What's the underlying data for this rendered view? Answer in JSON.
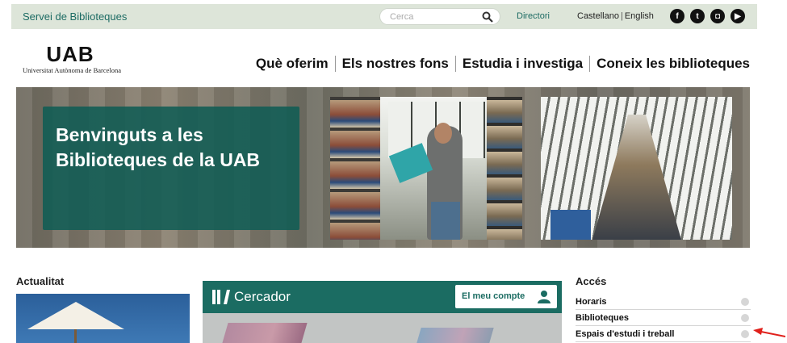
{
  "topbar": {
    "site_name": "Servei de Biblioteques",
    "search_placeholder": "Cerca",
    "directory": "Directori",
    "lang_castellano": "Castellano",
    "lang_separator": "|",
    "lang_english": "English",
    "social": [
      {
        "icon": "facebook-icon",
        "glyph": "f"
      },
      {
        "icon": "twitter-icon",
        "glyph": "t"
      },
      {
        "icon": "instagram-icon",
        "glyph": "◘"
      },
      {
        "icon": "youtube-icon",
        "glyph": "▶"
      }
    ]
  },
  "header": {
    "logo_text": "UAB",
    "logo_subtitle": "Universitat Autònoma de Barcelona",
    "nav": [
      "Què oferim",
      "Els nostres fons",
      "Estudia i investiga",
      "Coneix les biblioteques"
    ]
  },
  "banner": {
    "welcome": "Benvinguts a les Biblioteques de la UAB"
  },
  "news": {
    "title": "Actualitat"
  },
  "cercador": {
    "title": "Cercador",
    "account_button": "El meu compte"
  },
  "acces": {
    "title": "Accés",
    "links": [
      "Horaris",
      "Biblioteques",
      "Espais d'estudi i treball"
    ]
  },
  "colors": {
    "brand_green": "#1b6c62",
    "topbar_bg": "#dde5d9",
    "annotation_arrow": "#e0201b"
  }
}
